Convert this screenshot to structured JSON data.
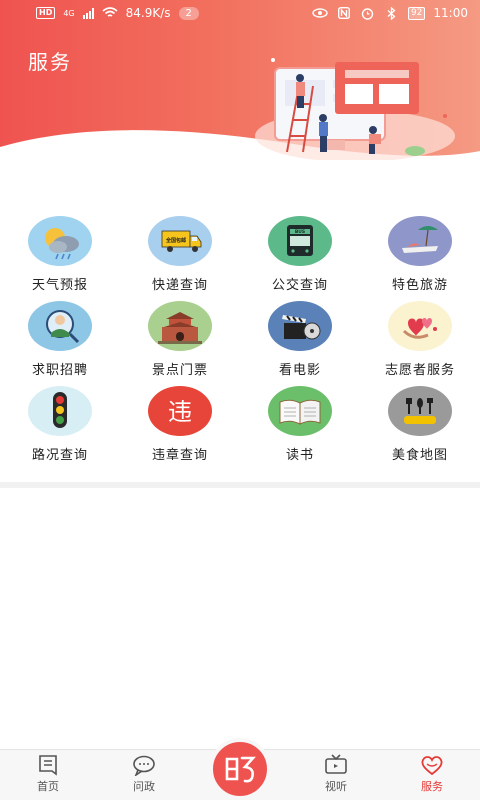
{
  "status_bar": {
    "hd": "HD",
    "network": "4G",
    "speed": "84.9K/s",
    "notifications": "2",
    "battery": "92",
    "time": "11:00"
  },
  "header": {
    "title": "服务"
  },
  "services": [
    {
      "label": "天气预报",
      "icon": "weather-icon"
    },
    {
      "label": "快递查询",
      "icon": "delivery-truck-icon"
    },
    {
      "label": "公交查询",
      "icon": "bus-icon"
    },
    {
      "label": "特色旅游",
      "icon": "travel-icon"
    },
    {
      "label": "求职招聘",
      "icon": "job-seeker-icon"
    },
    {
      "label": "景点门票",
      "icon": "landmark-gate-icon"
    },
    {
      "label": "看电影",
      "icon": "film-clapper-icon"
    },
    {
      "label": "志愿者服务",
      "icon": "volunteer-hearts-icon"
    },
    {
      "label": "路况查询",
      "icon": "traffic-light-icon"
    },
    {
      "label": "违章查询",
      "icon": "violation-icon"
    },
    {
      "label": "读书",
      "icon": "book-icon"
    },
    {
      "label": "美食地图",
      "icon": "food-map-icon"
    }
  ],
  "truck_text": "全国包邮",
  "bus_text": "BUS",
  "violation_char": "违",
  "bottom_nav": {
    "home": "首页",
    "politics": "问政",
    "video": "视听",
    "service": "服务",
    "active": "service"
  },
  "colors": {
    "accent": "#e53935",
    "header_start": "#ef5350",
    "header_end": "#f59a83"
  }
}
